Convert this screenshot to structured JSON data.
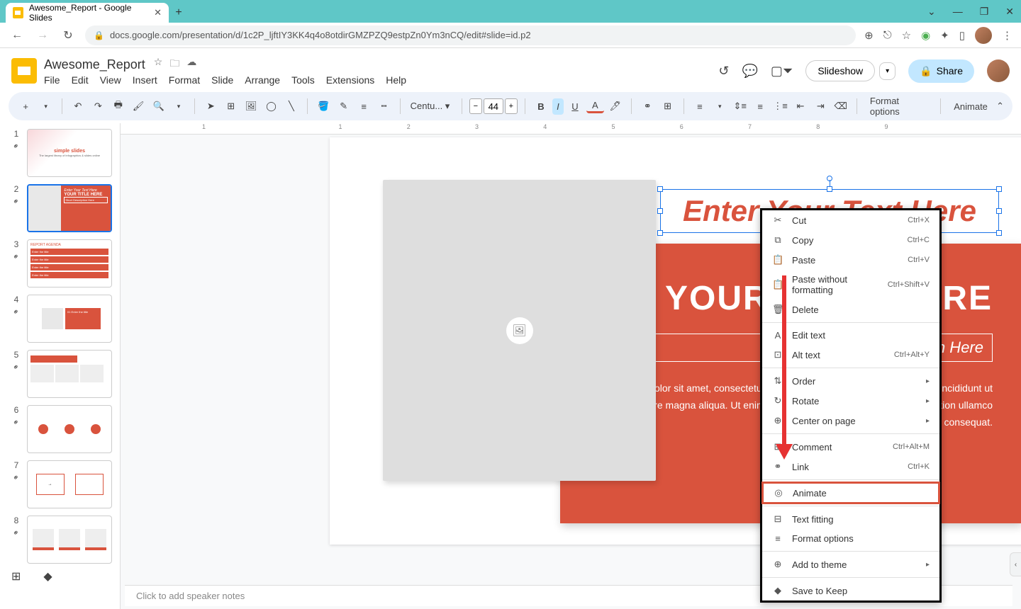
{
  "browser": {
    "tab_title": "Awesome_Report - Google Slides",
    "url": "docs.google.com/presentation/d/1c2P_ljftIY3KK4q4o8otdirGMZPZQ9estpZn0Ym3nCQ/edit#slide=id.p2"
  },
  "doc": {
    "title": "Awesome_Report",
    "menus": [
      "File",
      "Edit",
      "View",
      "Insert",
      "Format",
      "Slide",
      "Arrange",
      "Tools",
      "Extensions",
      "Help"
    ]
  },
  "header_actions": {
    "slideshow": "Slideshow",
    "share": "Share"
  },
  "toolbar": {
    "font": "Centu...",
    "font_size": "44",
    "format_options": "Format options",
    "animate": "Animate"
  },
  "ruler": [
    "1",
    "",
    "1",
    "2",
    "3",
    "4",
    "5",
    "6",
    "7",
    "8",
    "9",
    ""
  ],
  "slide": {
    "enter_text": "Enter Your Text Here",
    "title": "YOUR TITLE HERE",
    "desc": "Short Description Here",
    "lorem": "Lorem ipsum dolor sit amet, consectetur adipiscing elit, sed do eiusmod tempor incididunt ut labore et dolore magna aliqua. Ut enim ad minim veniam, quis nostrud exercitation ullamco laboris nisi ut aliquip ex ea commodo consequat."
  },
  "context_menu": {
    "items": [
      {
        "icon": "✂",
        "label": "Cut",
        "shortcut": "Ctrl+X"
      },
      {
        "icon": "⧉",
        "label": "Copy",
        "shortcut": "Ctrl+C"
      },
      {
        "icon": "📋",
        "label": "Paste",
        "shortcut": "Ctrl+V"
      },
      {
        "icon": "📋",
        "label": "Paste without formatting",
        "shortcut": "Ctrl+Shift+V"
      },
      {
        "icon": "🗑",
        "label": "Delete",
        "shortcut": ""
      },
      {
        "sep": true
      },
      {
        "icon": "A",
        "label": "Edit text",
        "shortcut": ""
      },
      {
        "icon": "⊡",
        "label": "Alt text",
        "shortcut": "Ctrl+Alt+Y"
      },
      {
        "sep": true
      },
      {
        "icon": "⇅",
        "label": "Order",
        "submenu": true
      },
      {
        "icon": "↻",
        "label": "Rotate",
        "submenu": true
      },
      {
        "icon": "⊕",
        "label": "Center on page",
        "submenu": true
      },
      {
        "sep": true
      },
      {
        "icon": "⊞",
        "label": "Comment",
        "shortcut": "Ctrl+Alt+M"
      },
      {
        "icon": "⚭",
        "label": "Link",
        "shortcut": "Ctrl+K"
      },
      {
        "sep": true
      },
      {
        "icon": "◎",
        "label": "Animate",
        "shortcut": "",
        "highlight": true
      },
      {
        "sep": true
      },
      {
        "icon": "⊟",
        "label": "Text fitting",
        "shortcut": ""
      },
      {
        "icon": "≡",
        "label": "Format options",
        "shortcut": ""
      },
      {
        "sep": true
      },
      {
        "icon": "⊕",
        "label": "Add to theme",
        "submenu": true
      },
      {
        "sep": true
      },
      {
        "icon": "◆",
        "label": "Save to Keep",
        "shortcut": ""
      }
    ]
  },
  "thumbs": [
    {
      "num": "1"
    },
    {
      "num": "2",
      "selected": true
    },
    {
      "num": "3"
    },
    {
      "num": "4"
    },
    {
      "num": "5"
    },
    {
      "num": "6"
    },
    {
      "num": "7"
    },
    {
      "num": "8"
    }
  ],
  "speaker_notes": "Click to add speaker notes",
  "thumb_text": {
    "t1a": "simple slides",
    "t1b": "The largest library of infographics & slides online",
    "t2a": "Enter Your Text Here",
    "t2b": "YOUR TITLE HERE",
    "t2c": "Short Description Here",
    "t3h": "REPORT AGENDA",
    "t3i": "Enter the title",
    "t4a": "01 Enter the title"
  }
}
